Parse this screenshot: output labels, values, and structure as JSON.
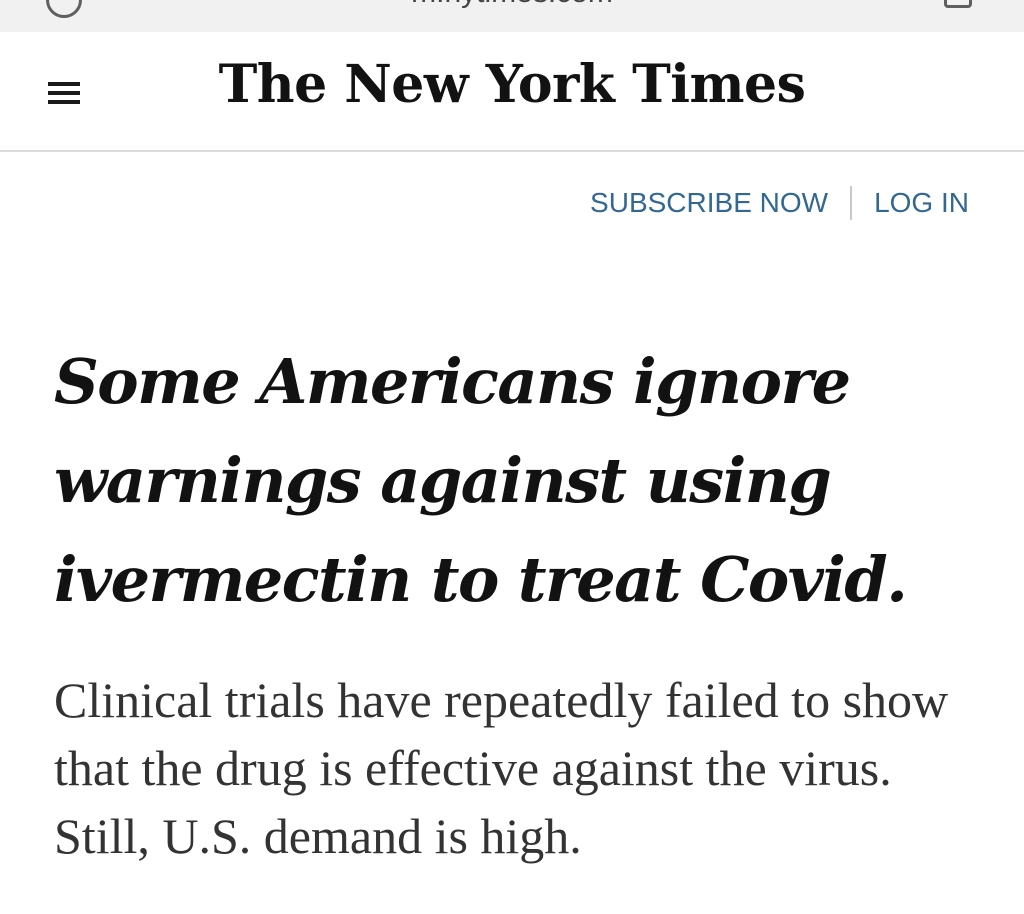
{
  "browser": {
    "url": "m.nytimes.com",
    "icons": [
      "site-info-icon",
      "tabs-icon"
    ]
  },
  "masthead": {
    "logo_text": "The New York Times",
    "menu_icon": "hamburger-menu-icon"
  },
  "account": {
    "subscribe_label": "SUBSCRIBE NOW",
    "login_label": "LOG IN"
  },
  "article": {
    "headline": "Some Americans ignore warnings against using ivermectin to treat Covid.",
    "summary": "Clinical trials have repeatedly failed to show that the drug is effective against the virus. Still, U.S. demand is high."
  },
  "colors": {
    "link": "#326891",
    "text": "#121212",
    "summary_text": "#333333",
    "rule": "#dcdcdc"
  }
}
